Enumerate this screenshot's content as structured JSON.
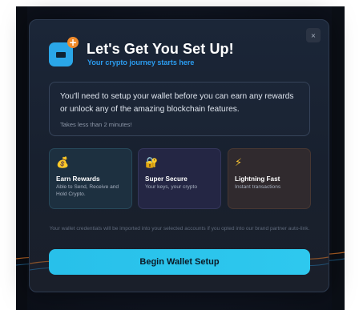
{
  "modal": {
    "title": "Let's Get You Set Up!",
    "subtitle": "Your crypto journey starts here",
    "close_label": "×",
    "info": {
      "main": "You'll need to setup your wallet before you can earn any rewards or unlock any of the amazing blockchain features.",
      "sub": "Takes less than 2 minutes!"
    },
    "features": [
      {
        "icon": "money-bag-icon",
        "glyph": "💰",
        "title": "Earn Rewards",
        "desc": "Able to Send, Receive and Hold Crypto."
      },
      {
        "icon": "lock-key-icon",
        "glyph": "🔐",
        "title": "Super Secure",
        "desc": "Your keys, your crypto"
      },
      {
        "icon": "lightning-icon",
        "glyph": "⚡",
        "title": "Lightning Fast",
        "desc": "Instant transactions"
      }
    ],
    "note": "Your wallet credentials will be imported into your selected accounts if you opted into our brand partner auto-link.",
    "cta_label": "Begin Wallet Setup"
  },
  "colors": {
    "accent": "#2bc3ec",
    "subtitle": "#2b9cf0",
    "logo_badge": "#f08a2a"
  }
}
